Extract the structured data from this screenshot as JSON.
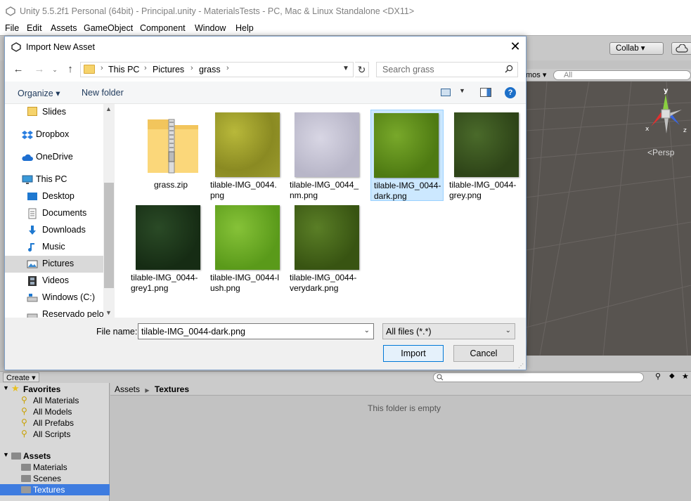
{
  "unity": {
    "title": "Unity 5.5.2f1 Personal (64bit) - Principal.unity - MaterialsTests - PC, Mac & Linux Standalone <DX11>",
    "menu": [
      "File",
      "Edit",
      "Assets",
      "GameObject",
      "Component",
      "Window",
      "Help"
    ],
    "collab_label": "Collab ▾",
    "scene_gizmos_label": "mos ▾",
    "scene_search_placeholder": "All",
    "persp_label": "Persp",
    "gizmo_labels": {
      "y": "y",
      "x": "x",
      "z": "z"
    },
    "project": {
      "create_label": "Create ▾",
      "breadcrumb": [
        "Assets",
        "Textures"
      ],
      "empty_message": "This folder is empty",
      "favorites_header": "Favorites",
      "favorites": [
        "All Materials",
        "All Models",
        "All Prefabs",
        "All Scripts"
      ],
      "assets_header": "Assets",
      "assets": [
        "Materials",
        "Scenes",
        "Textures"
      ]
    }
  },
  "dialog": {
    "title": "Import New Asset",
    "close_label": "✕",
    "address": [
      "This PC",
      "Pictures",
      "grass"
    ],
    "search_placeholder": "Search grass",
    "organize_label": "Organize ▾",
    "new_folder_label": "New folder",
    "help_label": "?",
    "nav_items": [
      {
        "label": "Slides"
      },
      {
        "label": "Dropbox"
      },
      {
        "label": "OneDrive"
      },
      {
        "label": "This PC"
      },
      {
        "label": "Desktop"
      },
      {
        "label": "Documents"
      },
      {
        "label": "Downloads"
      },
      {
        "label": "Music"
      },
      {
        "label": "Pictures"
      },
      {
        "label": "Videos"
      },
      {
        "label": "Windows (C:)"
      },
      {
        "label": "Reservado pelo S"
      }
    ],
    "files": [
      {
        "name": "grass.zip",
        "type": "zip"
      },
      {
        "name": "tilable-IMG_0044.png",
        "type": "image",
        "color": "#9a9a2c"
      },
      {
        "name": "tilable-IMG_0044_nm.png",
        "type": "image",
        "color": "#c4c2d4"
      },
      {
        "name": "tilable-IMG_0044-dark.png",
        "type": "image",
        "color": "#5c8c18",
        "selected": true
      },
      {
        "name": "tilable-IMG_0044-grey.png",
        "type": "image",
        "color": "#3a5220"
      },
      {
        "name": "tilable-IMG_0044-grey1.png",
        "type": "image",
        "color": "#1e3a1c"
      },
      {
        "name": "tilable-IMG_0044-lush.png",
        "type": "image",
        "color": "#6aaa22"
      },
      {
        "name": "tilable-IMG_0044-verydark.png",
        "type": "image",
        "color": "#44661a"
      }
    ],
    "file_name_label": "File name:",
    "file_name_value": "tilable-IMG_0044-dark.png",
    "file_type_value": "All files (*.*)",
    "import_label": "Import",
    "cancel_label": "Cancel"
  }
}
